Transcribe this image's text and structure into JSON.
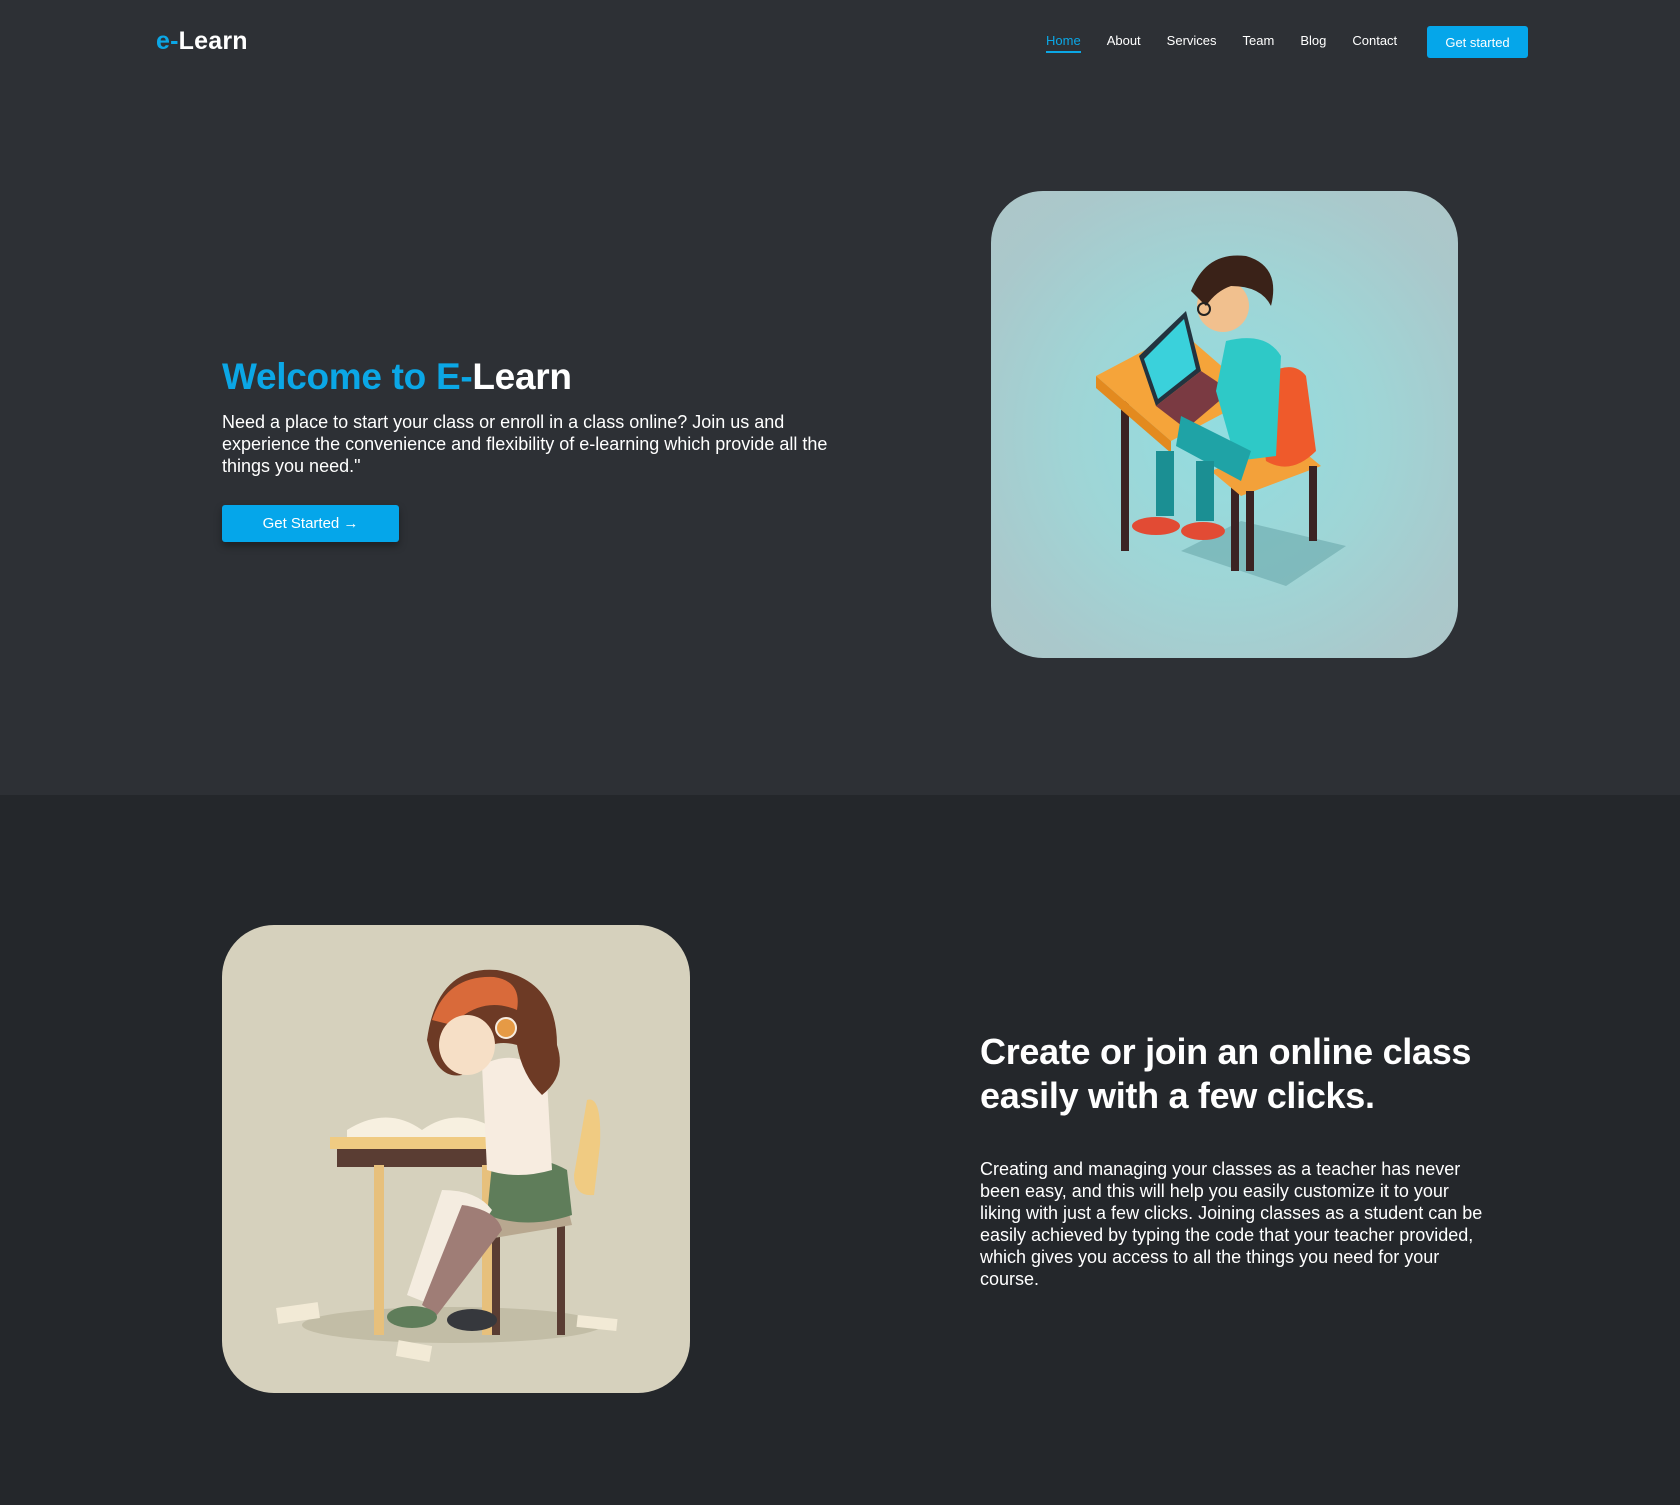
{
  "header": {
    "logo_prefix": "e-",
    "logo_main": "Learn",
    "nav": [
      {
        "label": "Home",
        "active": true
      },
      {
        "label": "About",
        "active": false
      },
      {
        "label": "Services",
        "active": false
      },
      {
        "label": "Team",
        "active": false
      },
      {
        "label": "Blog",
        "active": false
      },
      {
        "label": "Contact",
        "active": false
      }
    ],
    "cta_label": "Get started"
  },
  "hero": {
    "title_accent": "Welcome to E-",
    "title_rest": "Learn",
    "description": " Need a place to start your class or enroll in a class online? Join us and experience the convenience and flexibility of e-learning which provide all the things you need.\"",
    "cta_label": "Get Started →"
  },
  "section2": {
    "title": "Create or join an online class easily with a few clicks.",
    "description": "Creating and managing your classes as a teacher has never been easy, and this will help you easily customize it to your liking with just a few clicks. Joining classes as a student can be easily achieved by typing the code that your teacher provided, which gives you access to all the things you need for your course."
  },
  "colors": {
    "accent": "#0ba7e6",
    "button": "#05a6ea",
    "hero_bg": "#2d3035",
    "section2_bg": "#24272b"
  }
}
